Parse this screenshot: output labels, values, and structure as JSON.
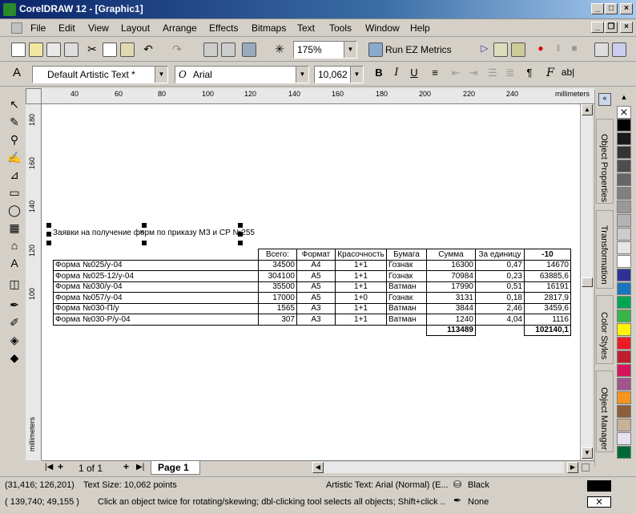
{
  "window": {
    "title": "CorelDRAW 12 - [Graphic1]"
  },
  "menu": [
    "File",
    "Edit",
    "View",
    "Layout",
    "Arrange",
    "Effects",
    "Bitmaps",
    "Text",
    "Tools",
    "Window",
    "Help"
  ],
  "standard_toolbar": {
    "zoom": "175%",
    "run_label": "Run EZ Metrics"
  },
  "text_toolbar": {
    "style": "Default Artistic Text *",
    "font": "Arial",
    "size": "10,062"
  },
  "ruler": {
    "units": "millimeters",
    "h_ticks": [
      "40",
      "60",
      "80",
      "100",
      "120",
      "140",
      "160",
      "180",
      "200",
      "220",
      "240"
    ],
    "v_ticks": [
      "180",
      "160",
      "140",
      "120",
      "100"
    ]
  },
  "document": {
    "heading": "Заявки на получение форм по приказу МЗ и СР №255",
    "table": {
      "header": [
        "",
        "Всего:",
        "Формат",
        "Красочность",
        "Бумага",
        "Сумма",
        "За единицу",
        "-10"
      ],
      "rows": [
        [
          "Форма №025/у-04",
          "34500",
          "A4",
          "1+1",
          "Гознак",
          "16300",
          "0,47",
          "14670"
        ],
        [
          "Форма №025-12/у-04",
          "304100",
          "A5",
          "1+1",
          "Гознак",
          "70984",
          "0,23",
          "63885,6"
        ],
        [
          "Форма №030/у-04",
          "35500",
          "A5",
          "1+1",
          "Ватман",
          "17990",
          "0,51",
          "16191"
        ],
        [
          "Форма №057/у-04",
          "17000",
          "A5",
          "1+0",
          "Гознак",
          "3131",
          "0,18",
          "2817,9"
        ],
        [
          "Форма №030-П/у",
          "1565",
          "A3",
          "1+1",
          "Ватман",
          "3844",
          "2,46",
          "3459,6"
        ],
        [
          "Форма №030-Р/у-04",
          "307",
          "A3",
          "1+1",
          "Ватман",
          "1240",
          "4,04",
          "1116"
        ]
      ],
      "total_sum": "113489",
      "total_discount": "102140,1"
    }
  },
  "page_nav": {
    "counter": "1 of 1",
    "page_tab": "Page 1"
  },
  "dockers": [
    "Object Properties",
    "Transformation",
    "Color Styles",
    "Object Manager"
  ],
  "status": {
    "coords": "(31,416; 126,201)",
    "text_size": "Text Size: 10,062 points",
    "object": "Artistic Text: Arial (Normal) (E...",
    "fill": "Black",
    "cursor": "( 139,740; 49,155 )",
    "hint": "Click an object twice for rotating/skewing; dbl-clicking tool selects all objects; Shift+click ...",
    "outline": "None"
  },
  "palette_colors": [
    "#000000",
    "#1a1a1a",
    "#333333",
    "#4d4d4d",
    "#666666",
    "#808080",
    "#999999",
    "#b3b3b3",
    "#cccccc",
    "#e6e6e6",
    "#ffffff",
    "#2e3192",
    "#1b75bc",
    "#00a651",
    "#39b54a",
    "#fff200",
    "#ed1c24",
    "#be1e2d",
    "#d4145a",
    "#a0568c",
    "#f7941d",
    "#8b5e3c",
    "#c7b299",
    "#e6e0f0",
    "#006837"
  ]
}
